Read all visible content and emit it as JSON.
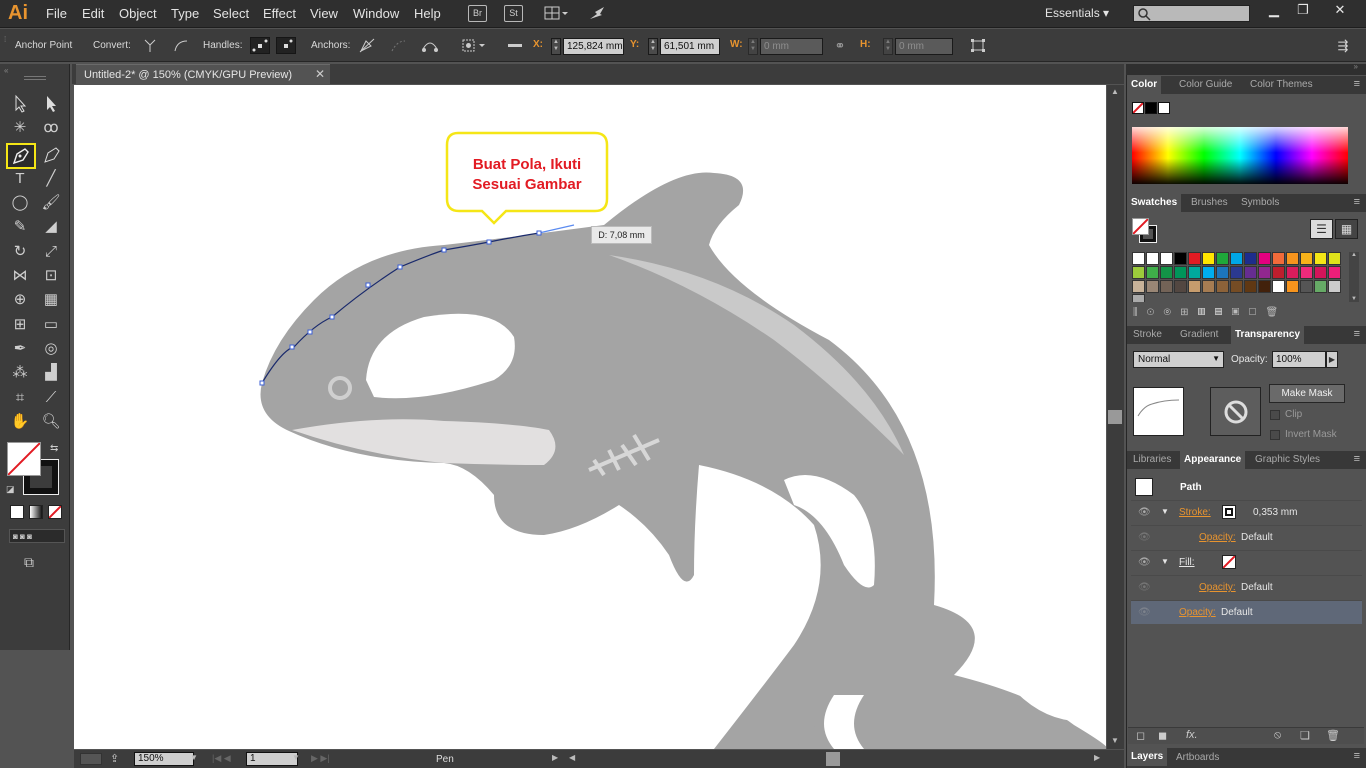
{
  "app": {
    "logo": "Ai"
  },
  "menu": [
    "File",
    "Edit",
    "Object",
    "Type",
    "Select",
    "Effect",
    "View",
    "Window",
    "Help"
  ],
  "menubar_icons": {
    "bridge": "Br",
    "stock": "St"
  },
  "workspace": "Essentials ▾",
  "control_bar": {
    "anchor_point": "Anchor Point",
    "convert": "Convert:",
    "handles": "Handles:",
    "anchors": "Anchors:",
    "x_label": "X:",
    "x_value": "125,824 mm",
    "y_label": "Y:",
    "y_value": "61,501 mm",
    "w_label": "W:",
    "w_value": "0 mm",
    "h_label": "H:",
    "h_value": "0 mm"
  },
  "document": {
    "tab": "Untitled-2* @ 150% (CMYK/GPU Preview)",
    "close": "✕"
  },
  "canvas": {
    "callout_line1": "Buat Pola, Ikuti",
    "callout_line2": "Sesuai Gambar",
    "distance_tooltip": "D: 7,08 mm"
  },
  "status": {
    "zoom": "150%",
    "artboard": "1",
    "tool": "Pen"
  },
  "color_panel": {
    "tabs": [
      "Color",
      "Color Guide",
      "Color Themes"
    ]
  },
  "swatches_panel": {
    "tabs": [
      "Swatches",
      "Brushes",
      "Symbols"
    ]
  },
  "transparency_panel": {
    "tabs": [
      "Stroke",
      "Gradient",
      "Transparency"
    ],
    "blend_mode": "Normal",
    "opacity_label": "Opacity:",
    "opacity_value": "100%",
    "make_mask": "Make Mask",
    "clip": "Clip",
    "invert_mask": "Invert Mask"
  },
  "appearance_panel": {
    "tabs": [
      "Libraries",
      "Appearance",
      "Graphic Styles"
    ],
    "title": "Path",
    "stroke_label": "Stroke:",
    "stroke_value": "0,353 mm",
    "opacity_label": "Opacity:",
    "opacity_default": "Default",
    "fill_label": "Fill:"
  },
  "bottom_tabs": [
    "Layers",
    "Artboards"
  ],
  "colors": {
    "accent": "#e8942f",
    "callout_border": "#f5e616",
    "callout_text": "#e21b23",
    "whale": "#a4a4a4"
  }
}
